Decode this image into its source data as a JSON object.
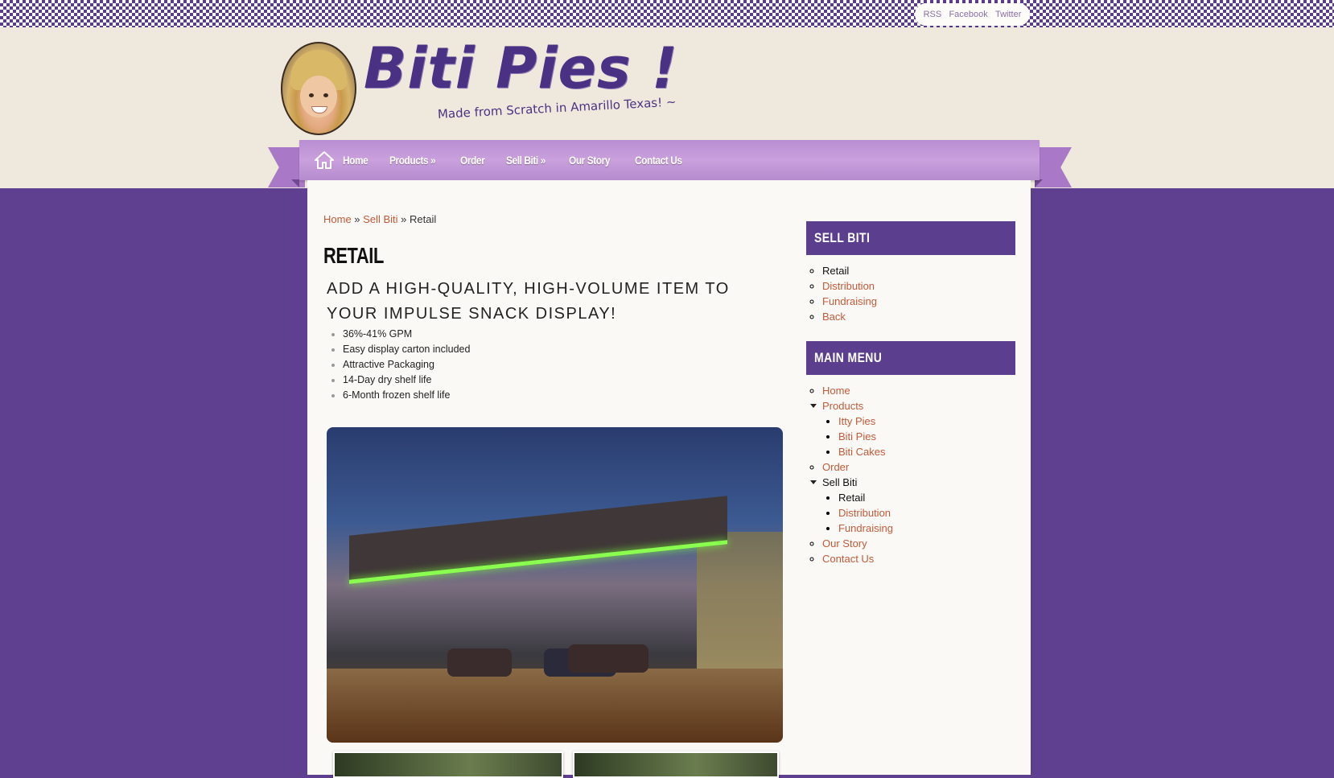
{
  "social": [
    "RSS",
    "Facebook",
    "Twitter"
  ],
  "site": {
    "title": "Biti Pies !",
    "tagline": "Made from Scratch in Amarillo Texas! ~"
  },
  "nav": {
    "items": [
      "Home",
      "Products »",
      "Order",
      "Sell Biti »",
      "Our Story",
      "Contact Us"
    ]
  },
  "breadcrumb": {
    "home": "Home",
    "sell_biti": "Sell Biti",
    "sep1": " » ",
    "sep2": " » ",
    "current": "Retail"
  },
  "page": {
    "title": "Retail",
    "subheading": "ADD A HIGH-QUALITY, HIGH-VOLUME ITEM TO YOUR IMPULSE SNACK DISPLAY!",
    "features": [
      "36%-41% GPM",
      "Easy display carton included",
      "Attractive Packaging",
      "14-Day dry shelf life",
      "6-Month frozen shelf life"
    ]
  },
  "sidebar": {
    "sell_biti": {
      "title": "Sell Biti",
      "items": [
        "Retail",
        "Distribution",
        "Fundraising",
        "Back"
      ]
    },
    "main_menu": {
      "title": "Main Menu",
      "home": "Home",
      "products": "Products",
      "products_children": [
        "Itty Pies",
        "Biti Pies",
        "Biti Cakes"
      ],
      "order": "Order",
      "sell_biti": "Sell Biti",
      "sell_biti_children": [
        "Retail",
        "Distribution",
        "Fundraising"
      ],
      "our_story": "Our Story",
      "contact_us": "Contact Us"
    }
  },
  "colors": {
    "accent_purple": "#5b3f8e",
    "nav_purple": "#b98ed4",
    "link": "#c25a3a",
    "background": "#5f3f8f"
  }
}
